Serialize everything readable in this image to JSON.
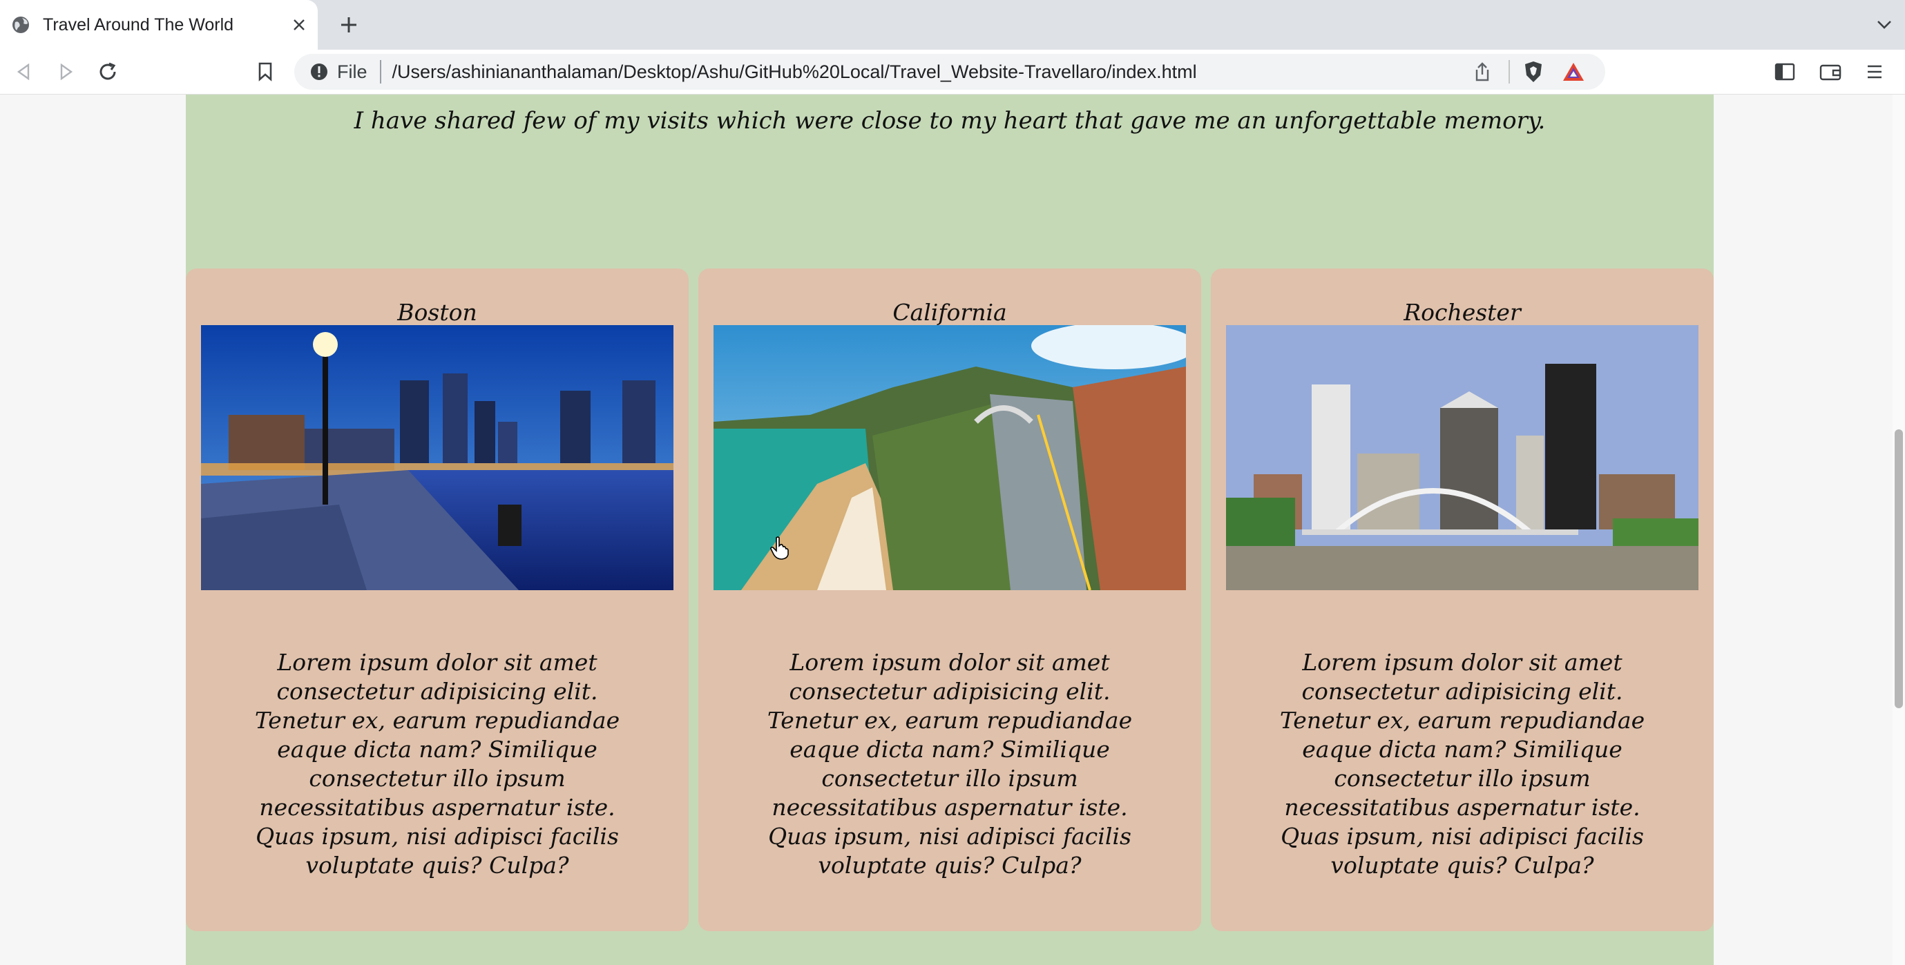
{
  "browser": {
    "tab_title": "Travel Around The World",
    "scheme_label": "File",
    "url": "/Users/ashiniananthalaman/Desktop/Ashu/GitHub%20Local/Travel_Website-Travellaro/index.html"
  },
  "page": {
    "tagline": "I have shared few of my visits which were close to my heart that gave me an unforgettable memory.",
    "cards": [
      {
        "city": "Boston",
        "description": "Lorem ipsum dolor sit amet consectetur adipisicing elit. Tenetur ex, earum repudiandae eaque dicta nam? Similique consectetur illo ipsum necessitatibus aspernatur iste. Quas ipsum, nisi adipisci facilis voluptate quis? Culpa?"
      },
      {
        "city": "California",
        "description": "Lorem ipsum dolor sit amet consectetur adipisicing elit. Tenetur ex, earum repudiandae eaque dicta nam? Similique consectetur illo ipsum necessitatibus aspernatur iste. Quas ipsum, nisi adipisci facilis voluptate quis? Culpa?"
      },
      {
        "city": "Rochester",
        "description": "Lorem ipsum dolor sit amet consectetur adipisicing elit. Tenetur ex, earum repudiandae eaque dicta nam? Similique consectetur illo ipsum necessitatibus aspernatur iste. Quas ipsum, nisi adipisci facilis voluptate quis? Culpa?"
      }
    ]
  },
  "colors": {
    "section_bg": "#c5d9b7",
    "card_bg": "#e0c1ab"
  }
}
